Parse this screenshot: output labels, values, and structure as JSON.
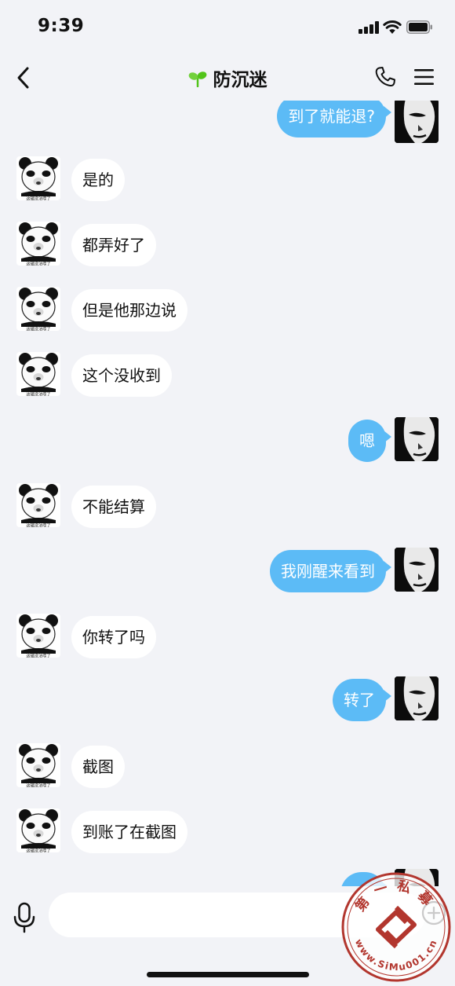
{
  "status_bar": {
    "time": "9:39",
    "signal_icon": "cellular-signal-icon",
    "wifi_icon": "wifi-icon",
    "battery_icon": "battery-icon"
  },
  "nav": {
    "title": "防沉迷",
    "back_icon": "chevron-left-icon",
    "title_icon": "sprout-icon",
    "phone_icon": "phone-icon",
    "menu_icon": "menu-icon"
  },
  "messages": [
    {
      "side": "right",
      "text": "到了就能退?"
    },
    {
      "side": "left",
      "text": "是的"
    },
    {
      "side": "left",
      "text": "都弄好了"
    },
    {
      "side": "left",
      "text": "但是他那边说"
    },
    {
      "side": "left",
      "text": "这个没收到"
    },
    {
      "side": "right",
      "text": "嗯"
    },
    {
      "side": "left",
      "text": "不能结算"
    },
    {
      "side": "right",
      "text": "我刚醒来看到"
    },
    {
      "side": "left",
      "text": "你转了吗"
    },
    {
      "side": "right",
      "text": "转了"
    },
    {
      "side": "left",
      "text": "截图"
    },
    {
      "side": "left",
      "text": "到账了在截图"
    }
  ],
  "avatars": {
    "panda_caption": "这磕没法唠了"
  },
  "input": {
    "value": "",
    "placeholder": ""
  },
  "watermark": {
    "top_text": "第一私募",
    "bottom_text": "www.SiMu001.cn"
  },
  "colors": {
    "background": "#f2f3f7",
    "outgoing_bubble": "#5cbbf6",
    "incoming_bubble": "#ffffff",
    "title_icon": "#52c41a"
  }
}
